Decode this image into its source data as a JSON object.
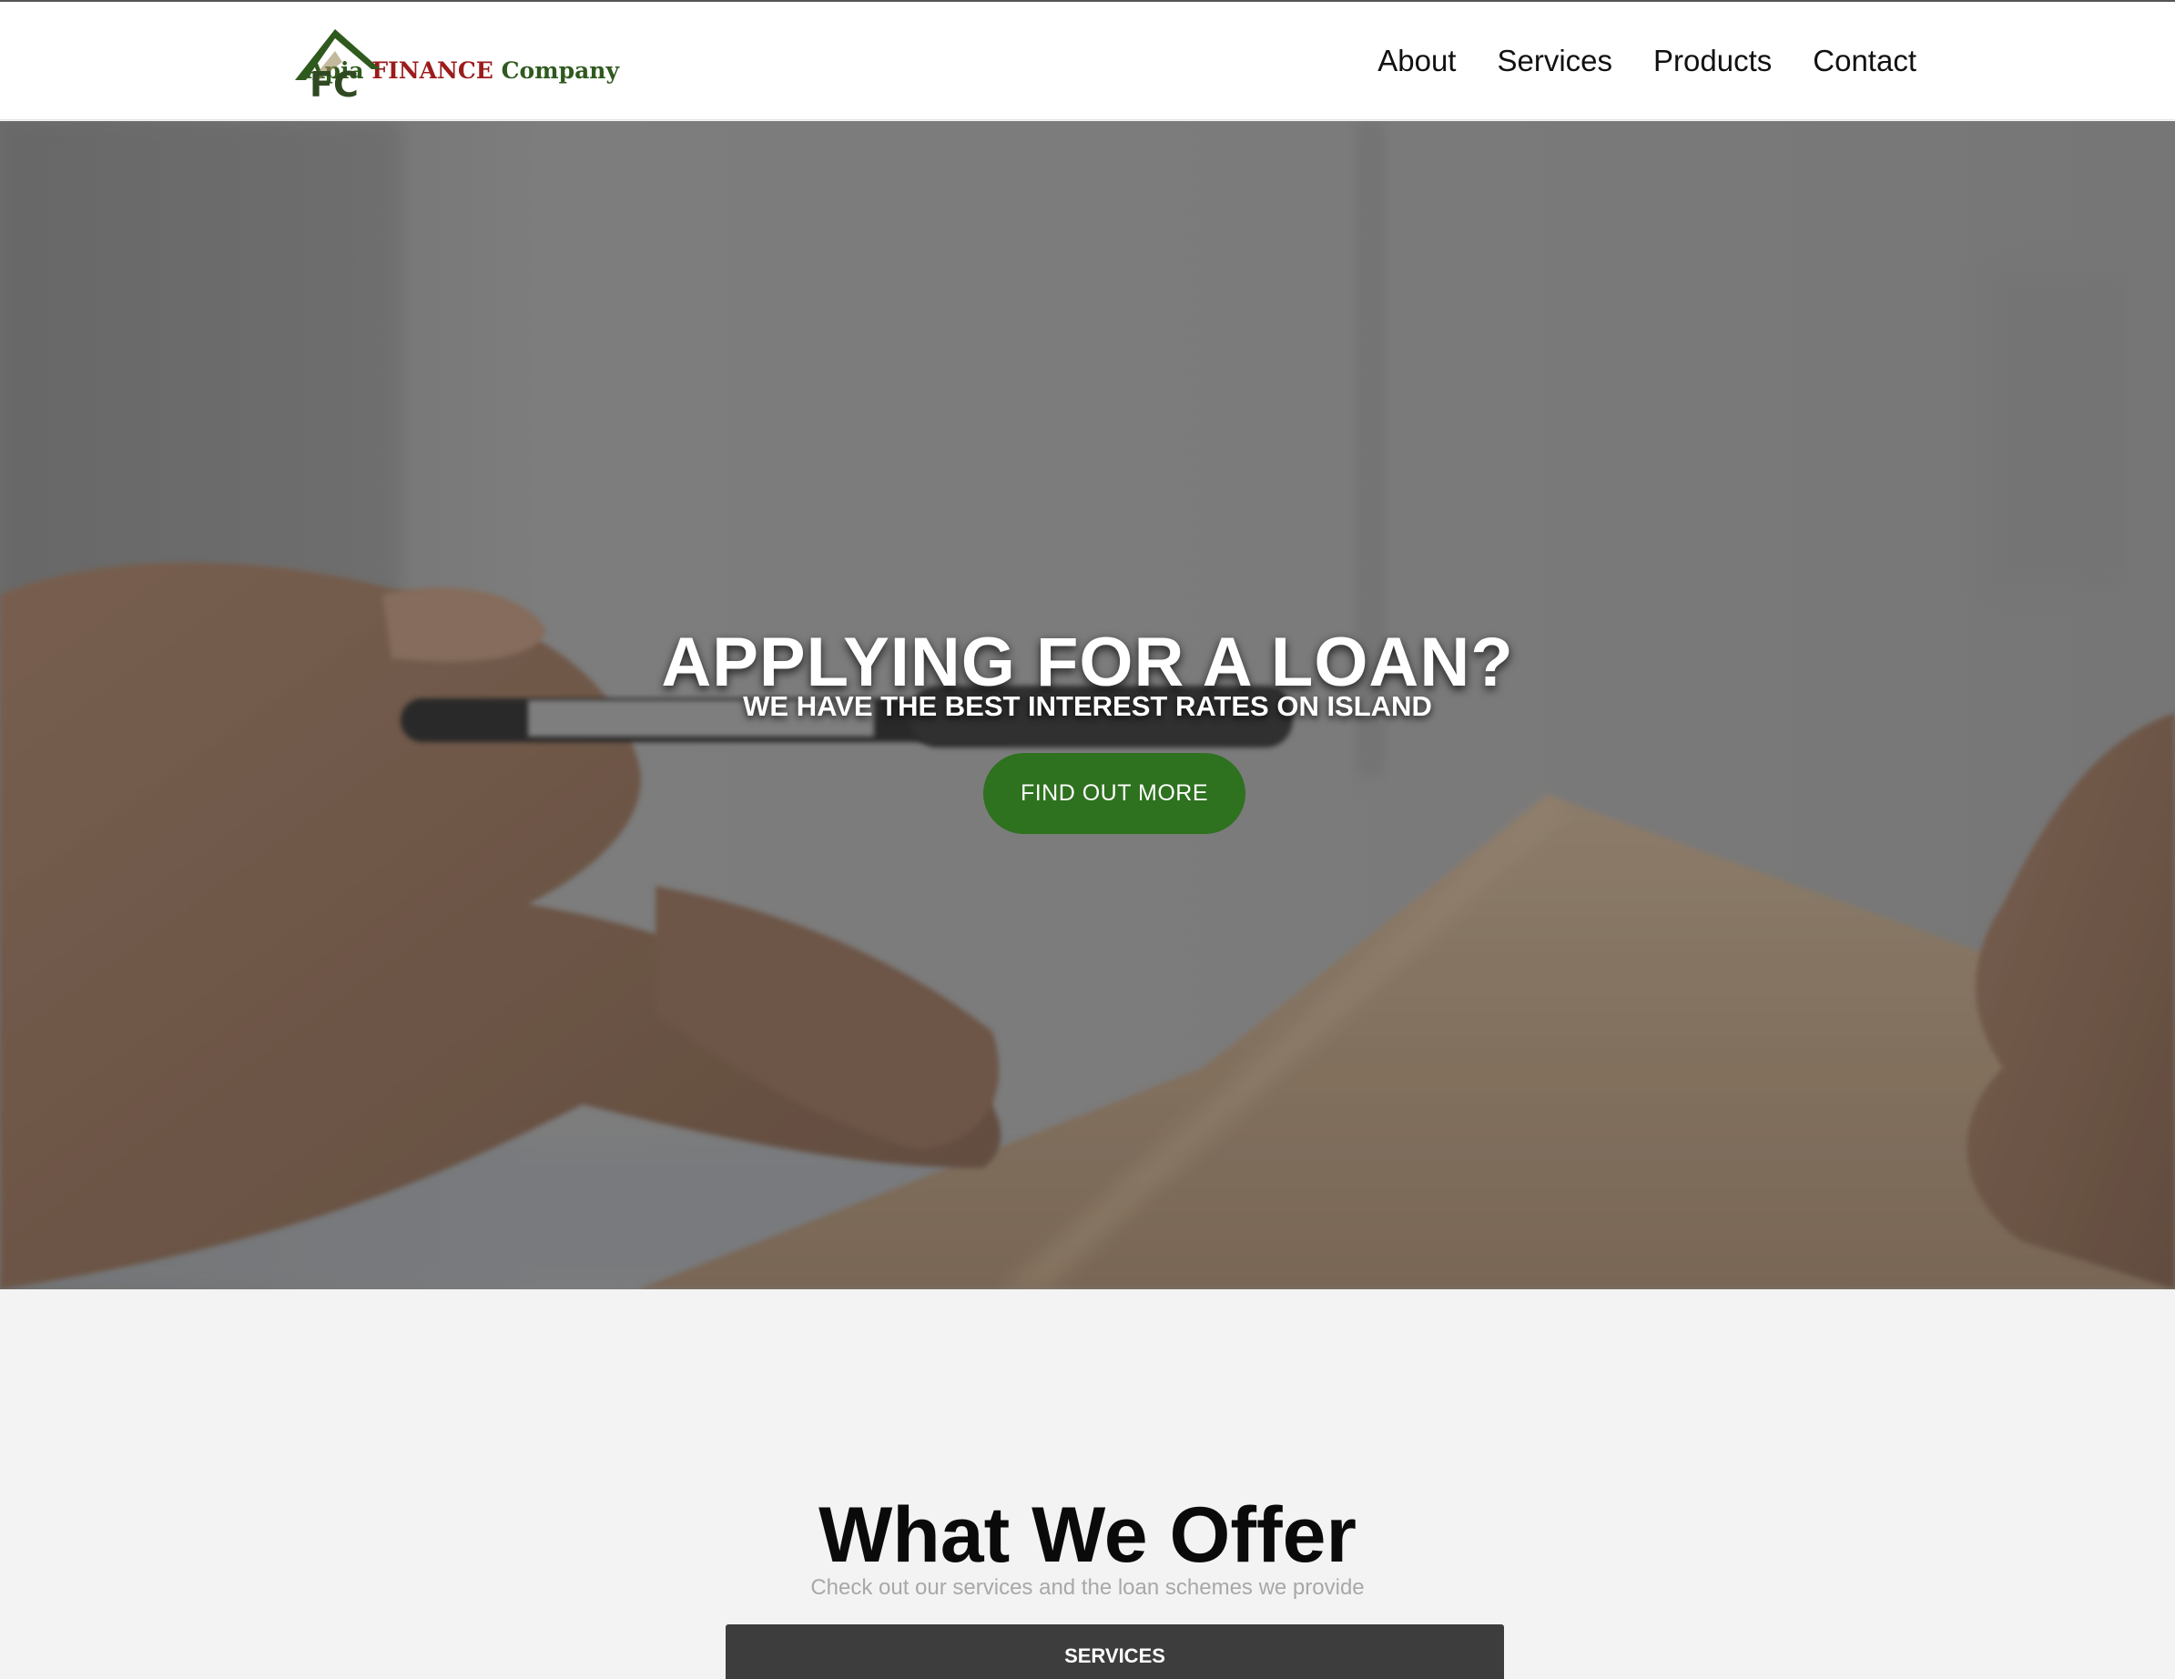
{
  "brand": {
    "logo_letters": "FC",
    "name_part1": "Apia",
    "name_part2": "FINANCE",
    "name_part3": "Company"
  },
  "nav": {
    "items": [
      {
        "label": "About"
      },
      {
        "label": "Services"
      },
      {
        "label": "Products"
      },
      {
        "label": "Contact"
      }
    ]
  },
  "hero": {
    "title": "APPLYING FOR A LOAN?",
    "subtitle": "WE HAVE THE BEST INTEREST RATES ON ISLAND",
    "cta_label": "FIND OUT MORE"
  },
  "offer": {
    "title": "What We Offer",
    "subtitle": "Check out our services and the loan schemes we provide",
    "tab_label": "SERVICES"
  },
  "colors": {
    "accent": "#2e711f",
    "brand_red": "#9b1c1c",
    "brand_green": "#2f5a1e",
    "tab_bg": "#3d3d3d"
  },
  "icons": {
    "logo": "house-roof-logo-icon"
  }
}
